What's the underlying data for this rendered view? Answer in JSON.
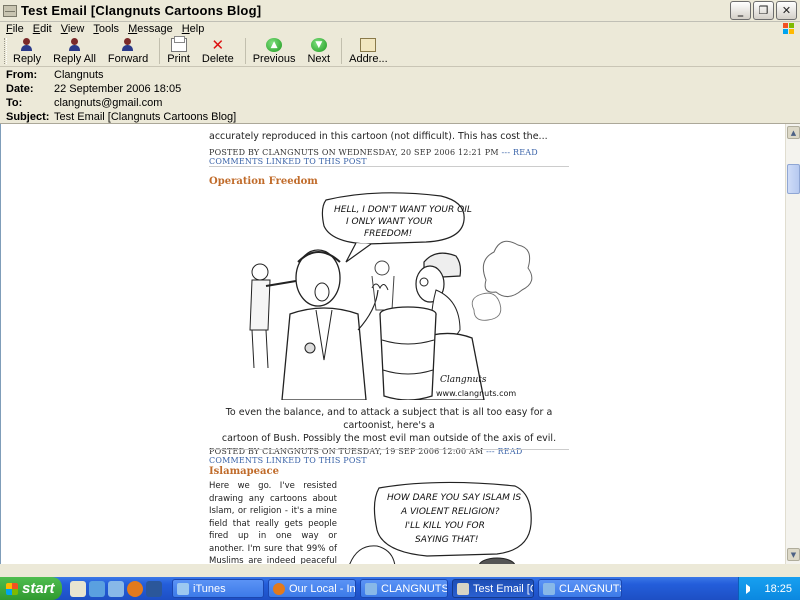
{
  "window": {
    "title": "Test Email [Clangnuts Cartoons Blog]"
  },
  "menu": [
    "File",
    "Edit",
    "View",
    "Tools",
    "Message",
    "Help"
  ],
  "toolbar": {
    "reply": "Reply",
    "reply_all": "Reply All",
    "forward": "Forward",
    "print": "Print",
    "delete": "Delete",
    "previous": "Previous",
    "next": "Next",
    "addresses": "Addre..."
  },
  "headers": {
    "from_label": "From:",
    "from": "Clangnuts",
    "date_label": "Date:",
    "date": "22 September 2006 18:05",
    "to_label": "To:",
    "to": "clangnuts@gmail.com",
    "subject_label": "Subject:",
    "subject": "Test Email [Clangnuts Cartoons Blog]"
  },
  "content": {
    "prev_tail": "accurately reproduced in this cartoon (not difficult). This has cost the...",
    "prev_meta": "POSTED BY CLANGNUTS ON WEDNESDAY, 20 SEP 2006 12:21 PM",
    "prev_link": "--- READ COMMENTS LINKED TO THIS POST",
    "post1_title": "Operation Freedom",
    "post1_bubble_1": "HELL, I DON'T WANT YOUR OIL",
    "post1_bubble_2": "I ONLY WANT YOUR",
    "post1_bubble_3": "FREEDOM!",
    "post1_credit": "www.clangnuts.com",
    "post1_signature": "Clangnuts",
    "post1_body_1": "To even the balance, and to attack a subject that is all too easy for a cartoonist, here's a",
    "post1_body_2": "cartoon of Bush. Possibly the most evil man outside of the axis of evil.",
    "post1_meta": "POSTED BY CLANGNUTS ON TUESDAY, 19 SEP 2006 12:00 AM",
    "post1_link": "--- READ COMMENTS LINKED TO THIS POST",
    "post2_title": "Islamapeace",
    "post2_text": "Here we go. I've resisted drawing any cartoons about Islam, or religion - it's a mine field that really gets people fired up in one way or another. I'm sure that 99% of Muslims are indeed peaceful people, but the fanatics really contradict themselves and do",
    "post2_bubble_1": "HOW DARE YOU SAY ISLAM IS",
    "post2_bubble_2": "A VIOLENT RELIGION?",
    "post2_bubble_3": "I'LL KILL YOU FOR",
    "post2_bubble_4": "SAYING THAT!"
  },
  "taskbar": {
    "start": "start",
    "tasks": [
      "iTunes",
      "Our Local - In...",
      "CLANGNUTS ...",
      "Test Email [Cl...",
      "CLANGNUTS ..."
    ],
    "clock": "18:25"
  }
}
